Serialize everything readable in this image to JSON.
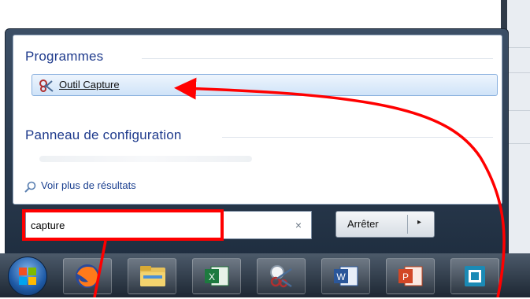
{
  "start_menu": {
    "programs_header": "Programmes",
    "program_result": {
      "label": "Outil Capture",
      "icon": "snipping-tool-icon"
    },
    "control_panel_header": "Panneau de configuration",
    "more_results_label": "Voir plus de résultats",
    "search": {
      "value": "capture",
      "clear_glyph": "×"
    },
    "stop_button_label": "Arrêter",
    "stop_button_arrow": "▸"
  },
  "taskbar": {
    "items": [
      {
        "icon": "windows-start-orb-icon"
      },
      {
        "icon": "firefox-icon"
      },
      {
        "icon": "file-explorer-icon"
      },
      {
        "icon": "excel-icon"
      },
      {
        "icon": "snipping-tool-icon"
      },
      {
        "icon": "word-icon"
      },
      {
        "icon": "powerpoint-icon"
      },
      {
        "icon": "app-icon"
      }
    ]
  },
  "annotation": {
    "color": "#ff0000"
  }
}
